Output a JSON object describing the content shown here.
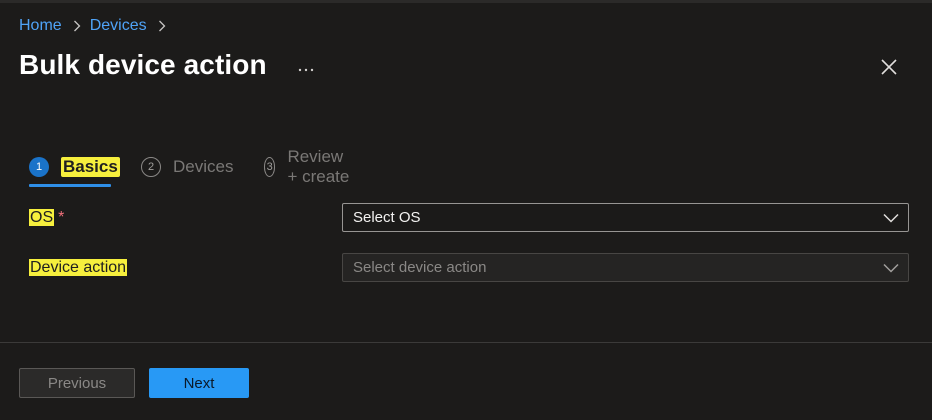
{
  "breadcrumb": {
    "items": [
      "Home",
      "Devices"
    ]
  },
  "header": {
    "title": "Bulk device action",
    "more_icon": "ellipsis-icon",
    "close_icon": "close-icon"
  },
  "wizard": {
    "tabs": [
      {
        "number": "1",
        "label": "Basics",
        "state": "active"
      },
      {
        "number": "2",
        "label": "Devices",
        "state": "inactive"
      },
      {
        "number": "3",
        "label": "Review + create",
        "state": "inactive"
      }
    ]
  },
  "form": {
    "os": {
      "label": "OS",
      "required_mark": "*",
      "value": "Select OS"
    },
    "device_action": {
      "label": "Device action",
      "placeholder": "Select device action"
    }
  },
  "footer": {
    "previous_label": "Previous",
    "next_label": "Next"
  },
  "colors": {
    "background": "#1c1b1a",
    "link": "#4fa3f7",
    "highlight": "#f6ef3d",
    "accent": "#2899f5",
    "required": "#f1707b"
  }
}
